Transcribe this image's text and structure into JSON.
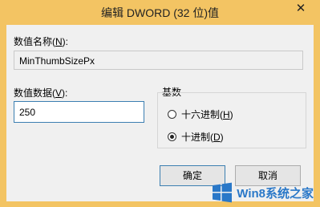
{
  "window": {
    "title": "编辑 DWORD (32 位)值",
    "close_glyph": "✕"
  },
  "value_name": {
    "label_prefix": "数值名称(",
    "label_key": "N",
    "label_suffix": "):",
    "value": "MinThumbSizePx"
  },
  "value_data": {
    "label_prefix": "数值数据(",
    "label_key": "V",
    "label_suffix": "):",
    "value": "250"
  },
  "base": {
    "label": "基数",
    "options": [
      {
        "label_prefix": "十六进制(",
        "label_key": "H",
        "label_suffix": ")",
        "checked": false
      },
      {
        "label_prefix": "十进制(",
        "label_key": "D",
        "label_suffix": ")",
        "checked": true
      }
    ]
  },
  "buttons": {
    "ok": "确定",
    "cancel": "取消"
  },
  "watermark": {
    "text": "Win8系统之家",
    "logo_color": "#2a78c8"
  },
  "colors": {
    "frame": "#f3c463",
    "client": "#f0f0f0",
    "focus_border": "#3c7fb1"
  }
}
